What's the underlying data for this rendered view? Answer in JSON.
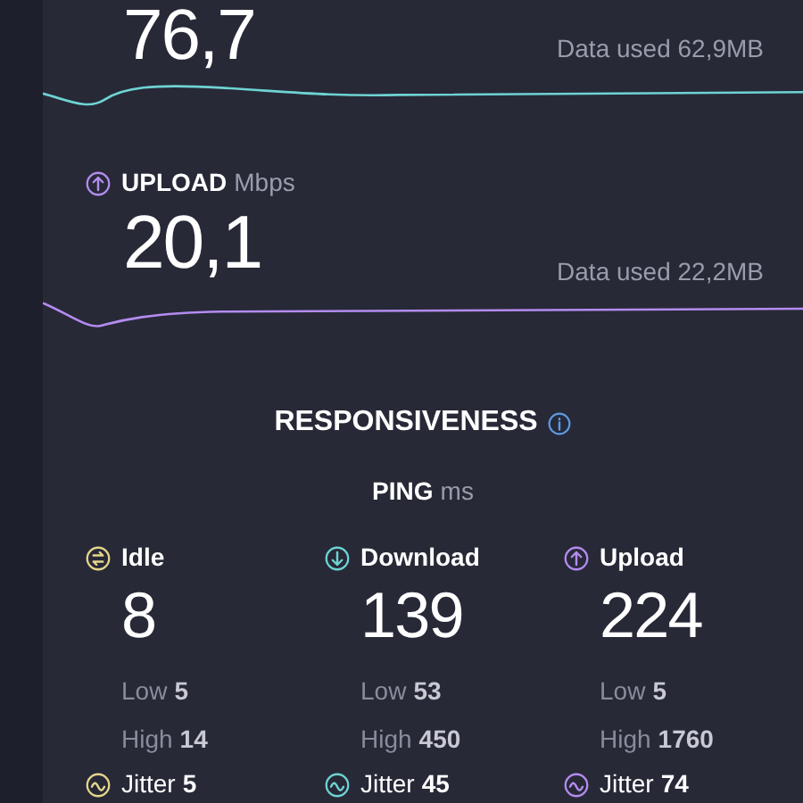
{
  "download": {
    "value": "76,7",
    "data_used": "Data used 62,9MB"
  },
  "upload": {
    "label": "UPLOAD",
    "unit": "Mbps",
    "value": "20,1",
    "data_used": "Data used 22,2MB"
  },
  "responsiveness": {
    "title": "RESPONSIVENESS",
    "ping_label": "PING",
    "ping_unit": "ms",
    "columns": [
      {
        "kind": "idle",
        "color": "#e6d68a",
        "label": "Idle",
        "value": "8",
        "low_label": "Low",
        "low": "5",
        "high_label": "High",
        "high": "14",
        "jitter_label": "Jitter",
        "jitter": "5"
      },
      {
        "kind": "download",
        "color": "#6fd3d3",
        "label": "Download",
        "value": "139",
        "low_label": "Low",
        "low": "53",
        "high_label": "High",
        "high": "450",
        "jitter_label": "Jitter",
        "jitter": "45"
      },
      {
        "kind": "upload",
        "color": "#b48cf0",
        "label": "Upload",
        "value": "224",
        "low_label": "Low",
        "low": "5",
        "high_label": "High",
        "high": "1760",
        "jitter_label": "Jitter",
        "jitter": "74"
      }
    ]
  }
}
